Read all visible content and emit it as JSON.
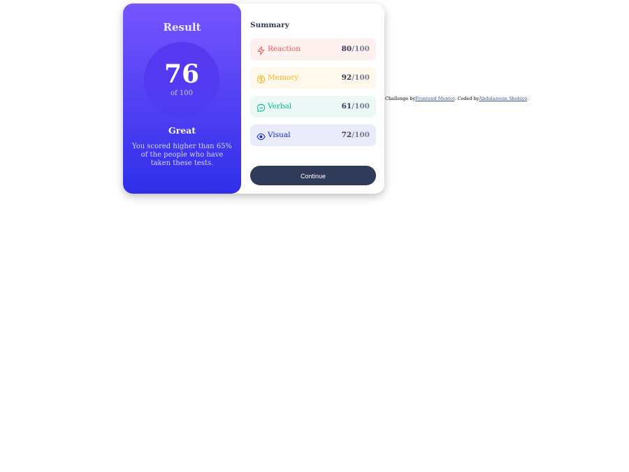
{
  "result": {
    "title": "Result",
    "score": "76",
    "of_label": "of 100",
    "rating": "Great",
    "description": "You scored higher than 65% of the people who have taken these tests."
  },
  "summary": {
    "title": "Summary",
    "items": [
      {
        "label": "Reaction",
        "score": "80",
        "max": "/100",
        "icon": "lightning-icon",
        "color": "#f55757",
        "bg": "#fff0f0"
      },
      {
        "label": "Memory",
        "score": "92",
        "max": "/100",
        "icon": "brain-icon",
        "color": "#ffb01f",
        "bg": "#fff8eb"
      },
      {
        "label": "Verbal",
        "score": "61",
        "max": "/100",
        "icon": "chat-bubble-icon",
        "color": "#00bb8f",
        "bg": "#ebf8f5"
      },
      {
        "label": "Visual",
        "score": "72",
        "max": "/100",
        "icon": "eye-icon",
        "color": "#1125d6",
        "bg": "#e9ebfb"
      }
    ],
    "continue_label": "Continue"
  },
  "attribution": {
    "prefix": "Challenge by",
    "link1": "Frontend Mentor",
    "middle": ". Coded by",
    "link2": "Abdulazeem Shobiyo",
    "suffix": "."
  }
}
